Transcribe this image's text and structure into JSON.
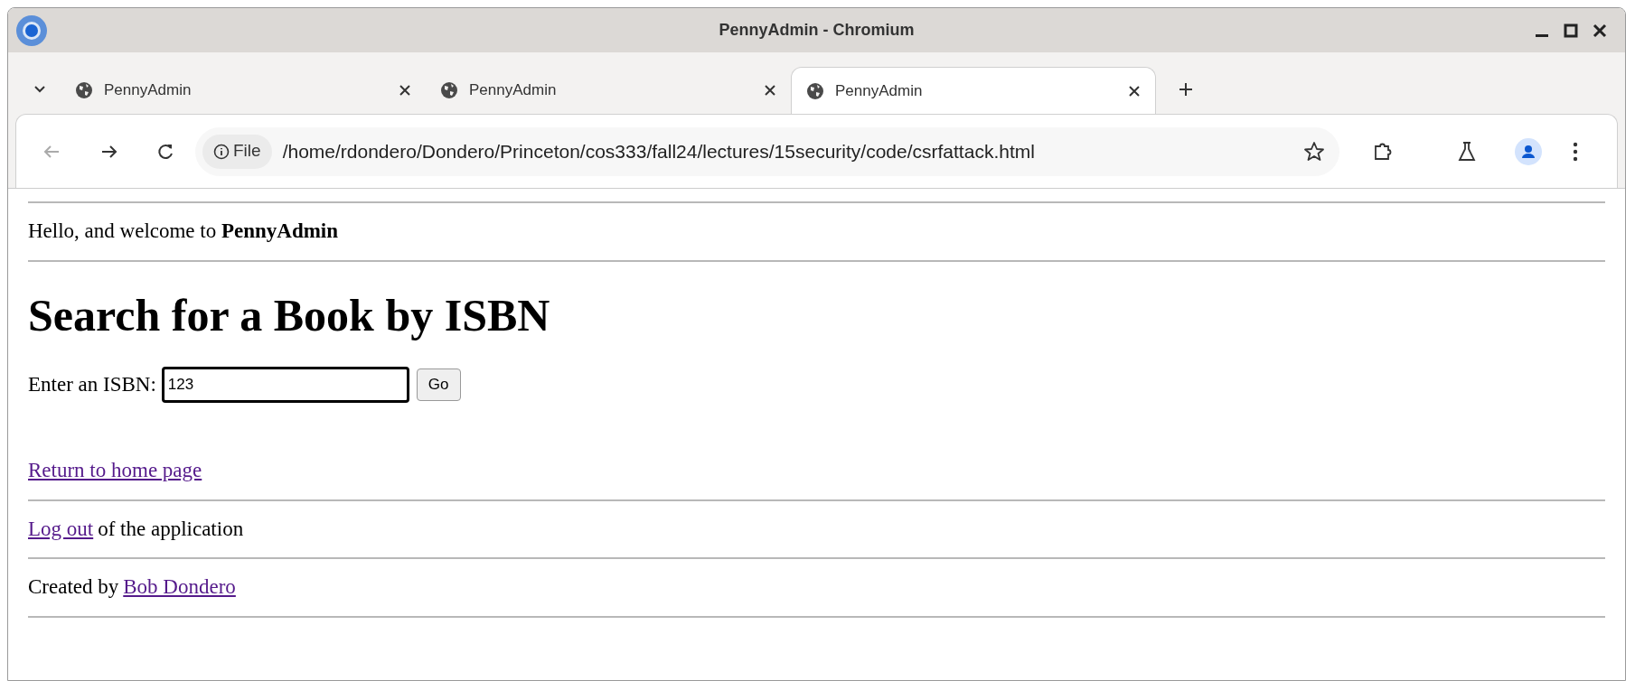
{
  "window": {
    "title": "PennyAdmin - Chromium"
  },
  "tabs": [
    {
      "label": "PennyAdmin",
      "selected": false
    },
    {
      "label": "PennyAdmin",
      "selected": false
    },
    {
      "label": "PennyAdmin",
      "selected": true
    }
  ],
  "address_bar": {
    "chip": "File",
    "url": "/home/rdondero/Dondero/Princeton/cos333/fall24/lectures/15security/code/csrfattack.html"
  },
  "page": {
    "greeting": "Hello, and welcome to **PennyAdmin**",
    "heading": "Search for a Book by ISBN",
    "form": {
      "label": "Enter an ISBN:",
      "value": "123",
      "button": "Go"
    },
    "home_link": "Return to home page",
    "logout": {
      "link": "Log out",
      "text": "of the application"
    },
    "credit": {
      "text": "Created by",
      "link": "Bob Dondero"
    }
  }
}
